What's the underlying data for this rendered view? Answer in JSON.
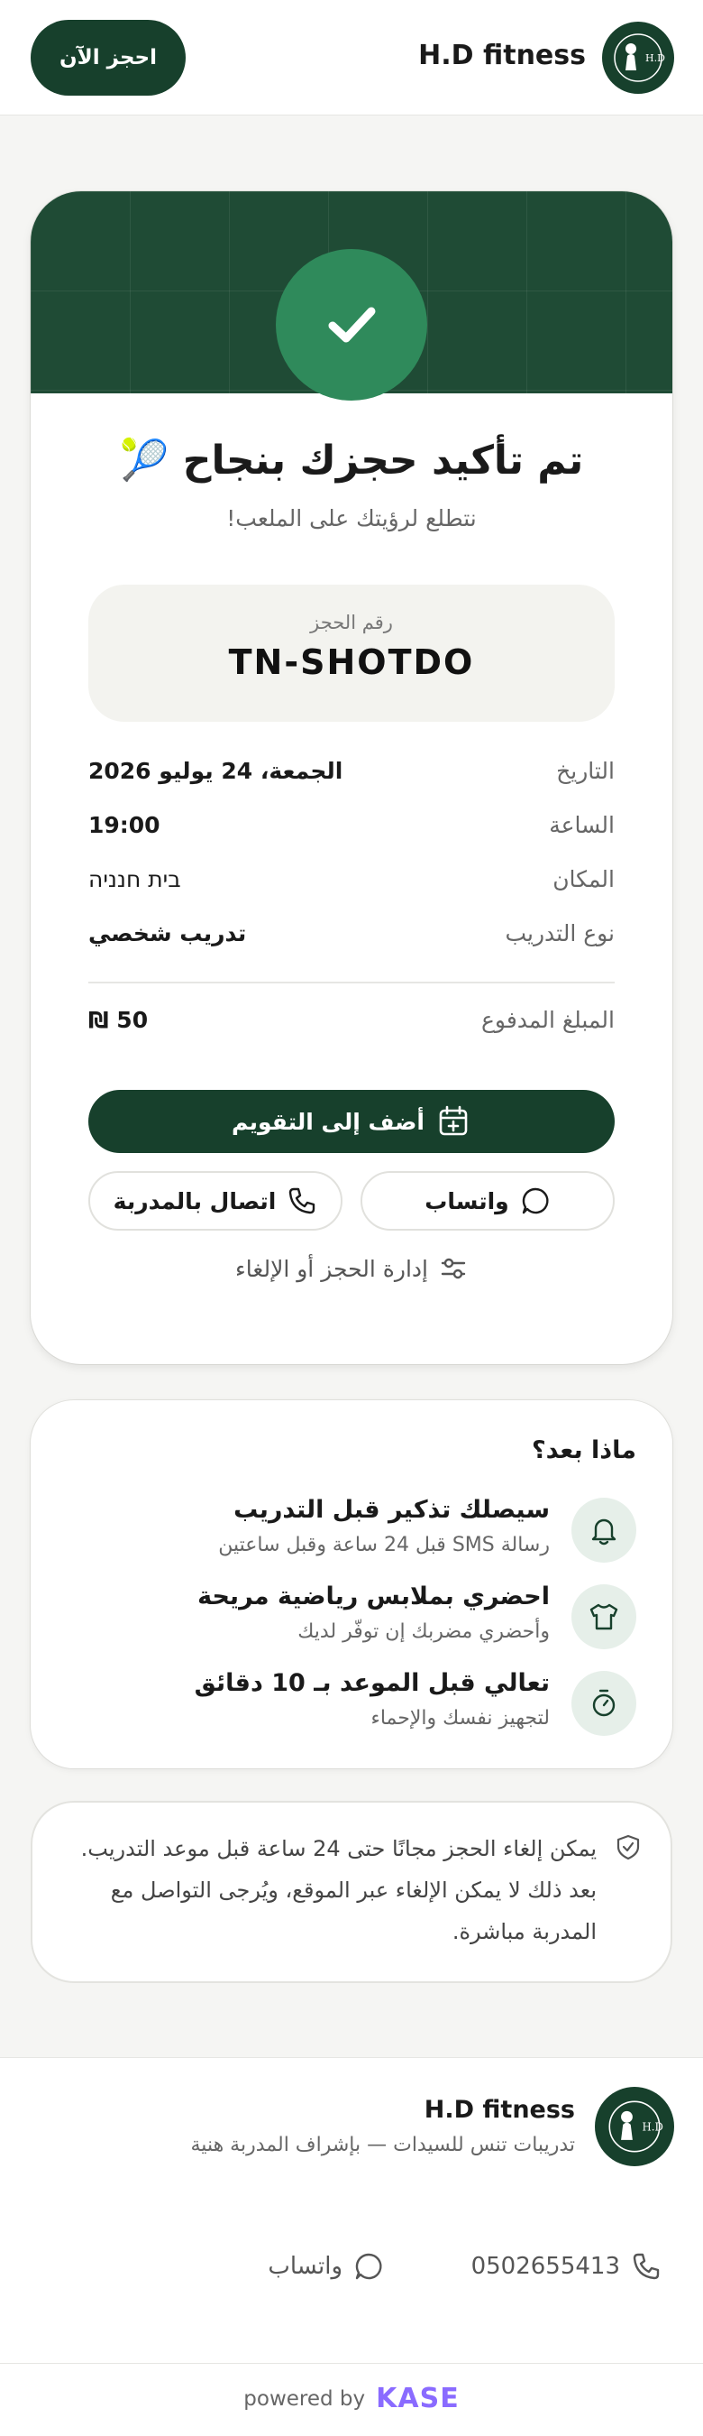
{
  "header": {
    "brand_name": "H.D fitness",
    "book_button": "احجز الآن"
  },
  "confirmation": {
    "title": "تم تأكيد حجزك بنجاح 🎾",
    "subtitle": "نتطلع لرؤيتك على الملعب!",
    "booking_ref_label": "رقم الحجز",
    "booking_ref": "TN-SHOTDO",
    "details": [
      {
        "label": "التاريخ",
        "value": "الجمعة، 24 يوليو 2026"
      },
      {
        "label": "الساعة",
        "value": "19:00"
      },
      {
        "label": "المكان",
        "value": "בית חנניה"
      },
      {
        "label": "نوع التدريب",
        "value": "تدريب شخصي"
      }
    ],
    "amount_label": "المبلغ المدفوع",
    "amount_value": "₪ 50",
    "add_to_calendar": "أضف إلى التقويم",
    "whatsapp": "واتساب",
    "call_coach": "اتصال بالمدربة",
    "manage": "إدارة الحجز أو الإلغاء"
  },
  "next_steps": {
    "title": "ماذا بعد؟",
    "items": [
      {
        "icon": "bell-icon",
        "title": "سيصلك تذكير قبل التدريب",
        "subtitle": "رسالة SMS قبل 24 ساعة وقبل ساعتين"
      },
      {
        "icon": "shirt-icon",
        "title": "احضري بملابس رياضية مريحة",
        "subtitle": "وأحضري مضربك إن توفّر لديك"
      },
      {
        "icon": "timer-icon",
        "title": "تعالي قبل الموعد بـ 10 دقائق",
        "subtitle": "لتجهيز نفسك والإحماء"
      }
    ]
  },
  "policy": {
    "text": "يمكن إلغاء الحجز مجانًا حتى 24 ساعة قبل موعد التدريب. بعد ذلك لا يمكن الإلغاء عبر الموقع، ويُرجى التواصل مع المدربة مباشرة."
  },
  "footer": {
    "brand_name": "H.D fitness",
    "tagline": "تدريبات تنس للسيدات — بإشراف المدربة هنية",
    "phone": "0502655413",
    "whatsapp": "واتساب",
    "powered_by": "powered by",
    "powered_brand": "KASE"
  },
  "colors": {
    "primary": "#17402c",
    "success": "#2f8a5b",
    "accent": "#8a6bff",
    "background": "#f5f5f3"
  }
}
